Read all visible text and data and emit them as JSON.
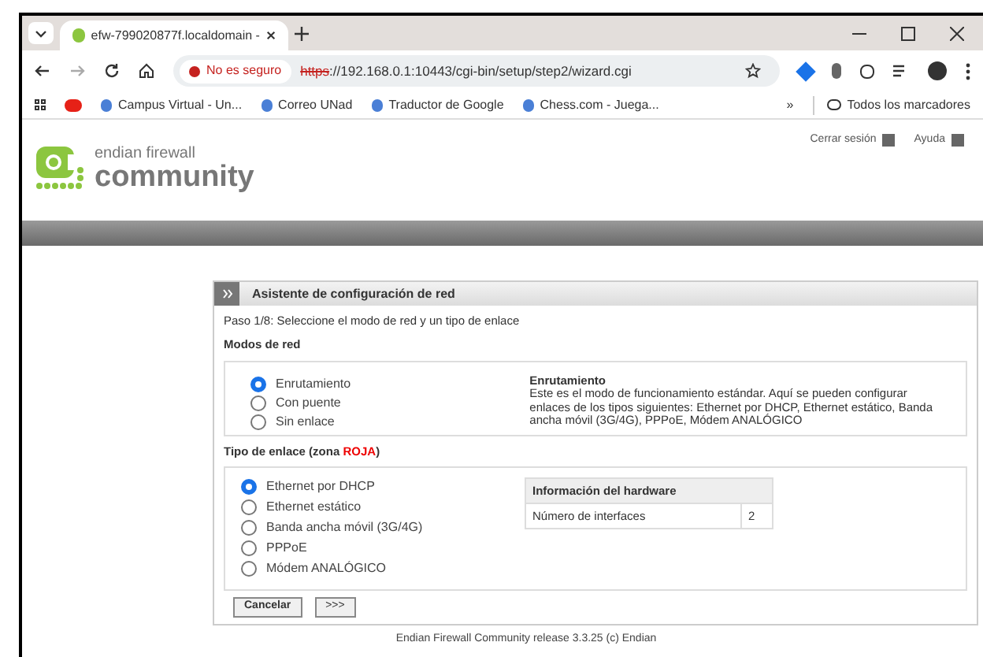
{
  "browser": {
    "tab_title": "efw-799020877f.localdomain - ",
    "security": "No es seguro",
    "url_scheme": "https",
    "url_rest": "://192.168.0.1:10443/cgi-bin/setup/step2/wizard.cgi",
    "bookmarks": [
      {
        "label": "Campus Virtual - Un..."
      },
      {
        "label": "Correo UNad"
      },
      {
        "label": "Traductor de Google"
      },
      {
        "label": "Chess.com - Juega..."
      }
    ],
    "overflow": "»",
    "all_bookmarks": "Todos los marcadores"
  },
  "header": {
    "logo_top": "endian firewall",
    "logo_bottom": "community",
    "links": [
      "Cerrar sesión",
      "Ayuda"
    ]
  },
  "panel": {
    "title": "Asistente de configuración de red",
    "step": "Paso 1/8: Seleccione el modo de red y un tipo de enlace",
    "modes_heading": "Modos de red",
    "modes": [
      {
        "label": "Enrutamiento",
        "selected": true
      },
      {
        "label": "Con puente",
        "selected": false
      },
      {
        "label": "Sin enlace",
        "selected": false
      }
    ],
    "mode_desc_title": "Enrutamiento",
    "mode_desc": "Este es el modo de funcionamiento estándar. Aquí se pueden configurar enlaces de los tipos siguientes: Ethernet por DHCP, Ethernet estático, Banda ancha móvil (3G/4G), PPPoE, Módem ANALÓGICO",
    "link_heading": "Tipo de enlace (zona **ROJA**)",
    "links": [
      {
        "label": "Ethernet por DHCP",
        "selected": true
      },
      {
        "label": "Ethernet estático",
        "selected": false
      },
      {
        "label": "Banda ancha móvil (3G/4G)",
        "selected": false
      },
      {
        "label": "PPPoE",
        "selected": false
      },
      {
        "label": "Módem ANALÓGICO",
        "selected": false
      }
    ],
    "hardware": {
      "title": "Información del hardware",
      "rows": [
        {
          "label": "Número de interfaces",
          "value": "2"
        }
      ]
    },
    "buttons": [
      "Cancelar",
      ">>>"
    ]
  },
  "footer": "Endian Firewall Community release 3.3.25 (c) Endian"
}
